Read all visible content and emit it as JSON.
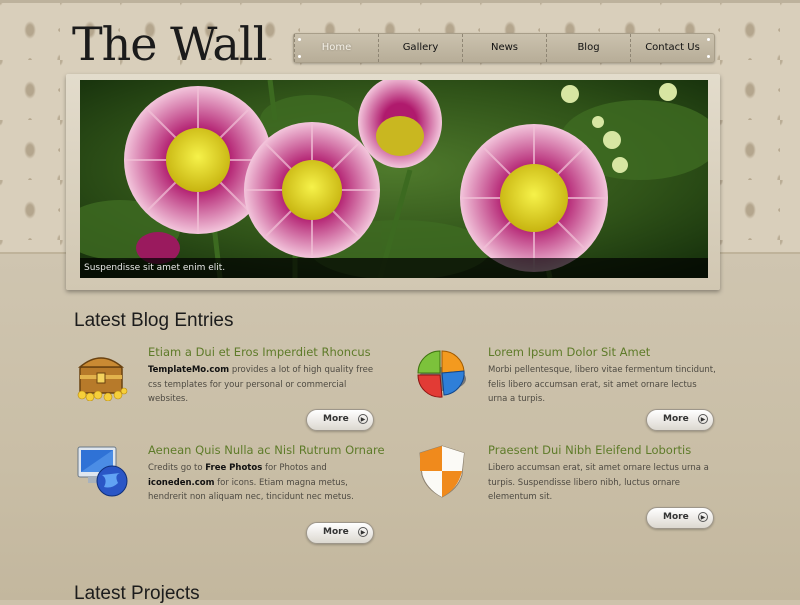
{
  "site": {
    "logo": "The Wall"
  },
  "nav": {
    "items": [
      {
        "label": "Home"
      },
      {
        "label": "Gallery"
      },
      {
        "label": "News"
      },
      {
        "label": "Blog"
      },
      {
        "label": "Contact Us"
      }
    ]
  },
  "banner": {
    "caption": "Suspendisse sit amet enim elit."
  },
  "blog": {
    "heading": "Latest Blog Entries",
    "entries": [
      {
        "icon": "treasure-chest-icon",
        "title": "Etiam a Dui et Eros Imperdiet Rhoncus",
        "parts": [
          "TemplateMo.com",
          " provides a lot of high quality free css templates for your personal or commercial websites."
        ],
        "more": "More"
      },
      {
        "icon": "pie-chart-icon",
        "title": "Lorem Ipsum Dolor Sit Amet",
        "parts": [
          "Morbi pellentesque, libero vitae fermentum tincidunt, felis libero accumsan erat, sit amet ornare lectus urna a turpis."
        ],
        "more": "More"
      },
      {
        "icon": "monitor-globe-icon",
        "title": "Aenean Quis Nulla ac Nisl Rutrum Ornare",
        "parts": [
          "Credits go to ",
          "Free Photos",
          " for Photos and ",
          "iconeden.com",
          " for icons. Etiam magna metus, hendrerit non aliquam nec, tincidunt nec metus."
        ],
        "more": "More"
      },
      {
        "icon": "shield-icon",
        "title": "Praesent Dui Nibh Eleifend Lobortis",
        "parts": [
          "Libero accumsan erat, sit amet ornare lectus urna a turpis. Suspendisse libero nibh, luctus ornare elementum sit."
        ],
        "more": "More"
      }
    ]
  },
  "projects": {
    "heading": "Latest Projects"
  }
}
